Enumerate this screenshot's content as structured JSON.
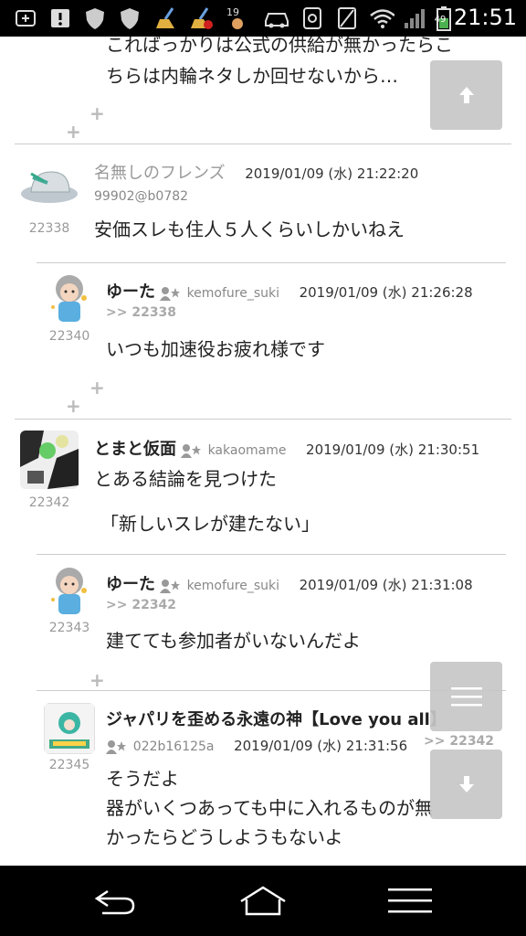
{
  "status_bar": {
    "time": "21:51",
    "battery": "49",
    "icons": [
      "add-box-icon",
      "alert-icon",
      "shield-icon",
      "shield-icon",
      "broom-icon",
      "broom-alert-icon",
      "weather-icon",
      "car-icon",
      "mobile-icon",
      "no-sim-icon",
      "wifi-icon",
      "signal-icon",
      "battery-icon"
    ]
  },
  "top_partial": {
    "line1": "こればっかりは公式の供給が無かったらこ",
    "line2": "ちらは内輪ネタしか回せないから…"
  },
  "posts": [
    {
      "num": "22338",
      "name": "名無しのフレンズ",
      "date": "2019/01/09 (水) 21:22:20",
      "uid": "99902@b0782",
      "body": [
        "安価スレも住人５人くらいしかいねえ"
      ]
    },
    {
      "num": "22340",
      "name": "ゆーた",
      "user_id": "kemofure_suki",
      "date": "2019/01/09 (水) 21:26:28",
      "reply_to": ">> 22338",
      "body": [
        "いつも加速役お疲れ様です"
      ]
    },
    {
      "num": "22342",
      "name": "とまと仮面",
      "user_id": "kakaomame",
      "date": "2019/01/09 (水) 21:30:51",
      "body": [
        "とある結論を見つけた",
        "「新しいスレが建たない」"
      ]
    },
    {
      "num": "22343",
      "name": "ゆーた",
      "user_id": "kemofure_suki",
      "date": "2019/01/09 (水) 21:31:08",
      "reply_to": ">> 22342",
      "body": [
        "建てても参加者がいないんだよ"
      ]
    },
    {
      "num": "22345",
      "name": "ジャパリを歪める永遠の神【Love you all】",
      "user_id": "022b16125a",
      "date": "2019/01/09 (水) 21:31:56",
      "reply_to": ">> 22342",
      "body": [
        "そうだよ",
        "器がいくつあっても中に入れるものが無",
        "かったらどうしようもないよ"
      ]
    }
  ],
  "plus_symbol": "+",
  "fab": {
    "up": "scroll-up-icon",
    "menu": "menu-icon",
    "down": "scroll-down-icon"
  },
  "navbar": {
    "back": "back-icon",
    "home": "home-icon",
    "menu": "menu-icon"
  }
}
